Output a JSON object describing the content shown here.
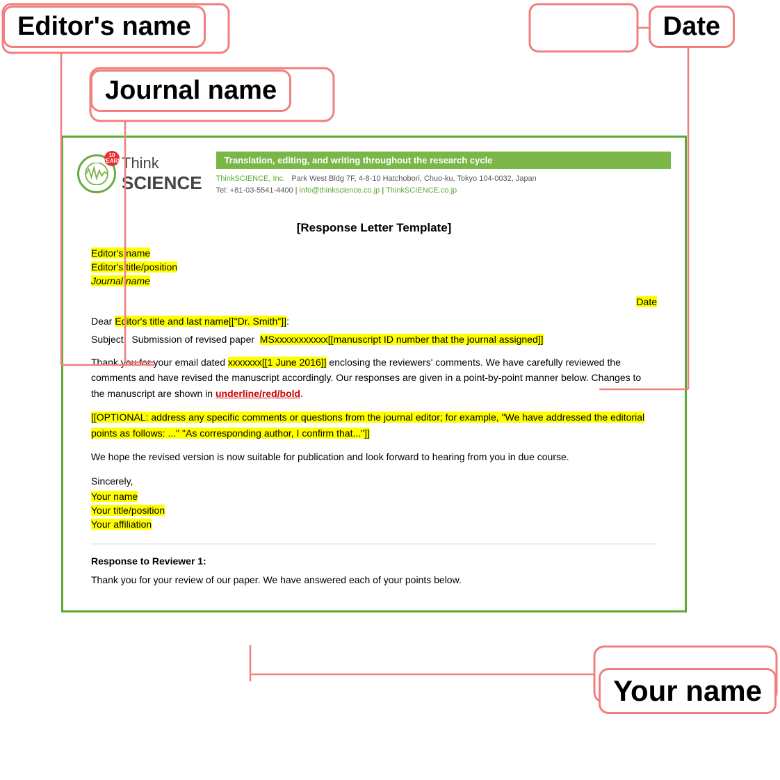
{
  "annotations": {
    "editors_name_label": "Editor's name",
    "journal_name_label": "Journal name",
    "date_label": "Date",
    "your_name_label": "Your name"
  },
  "letter": {
    "title": "[Response Letter Template]",
    "header": {
      "logo_10": "10",
      "logo_years": "YEARS",
      "logo_think": "Think",
      "logo_science": "SCIENCE",
      "tagline": "Translation, editing, and writing throughout the research cycle",
      "company": "ThinkSCIENCE, Inc.",
      "address": "Park West Bldg 7F, 4-8-10 Hatchobori, Chuo-ku, Tokyo 104-0032, Japan",
      "tel": "Tel: +81-03-5541-4400",
      "email": "info@thinkscience.co.jp",
      "website": "ThinkSCIENCE.co.jp"
    },
    "fields": {
      "editors_name": "Editor's name",
      "editors_title": "Editor's title/position",
      "journal_name": "Journal name",
      "date": "Date",
      "dear": "Dear Editor's title and last name[[\"Dr. Smith\"]]:",
      "dear_highlight": "Editor's title and last name[[\"Dr. Smith\"]]",
      "subject_prefix": "Subject:  Submission of revised paper  ",
      "subject_highlight": "MSxxxxxxxxxxx[[manuscript ID number that the journal assigned]]",
      "body1_prefix": "Thank you for your email dated ",
      "body1_date_highlight": "xxxxxxx[[1 June 2016]]",
      "body1_suffix": " enclosing the reviewers' comments. We have carefully reviewed the comments and have revised the manuscript accordingly. Our responses are given in a point-by-point manner below. Changes to the manuscript are shown in ",
      "body1_underline": "underline/red/bold",
      "body1_end": ".",
      "optional_text": "[[OPTIONAL: address any specific comments or questions from the journal editor; for example, \"We have addressed the editorial points as follows: ...\" \"As corresponding author, I confirm that...\"]]",
      "body2": "We hope the revised version is now suitable for publication and look forward to hearing from you in due course.",
      "sincerely": "Sincerely,",
      "your_name": "Your name",
      "your_title": "Your title/position",
      "your_affiliation": "Your affiliation",
      "response_title": "Response to Reviewer 1:",
      "response_body": "Thank you for your review of our paper. We have answered each of your points below."
    }
  },
  "colors": {
    "highlight_yellow": "#ffff00",
    "annotation_red": "#f08080",
    "green_border": "#5aaa32",
    "logo_green": "#7ab648"
  }
}
